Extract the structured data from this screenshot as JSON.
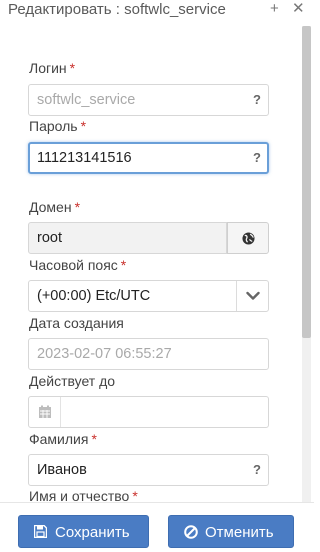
{
  "header": {
    "title": "Редактировать : softwlc_service",
    "plus_glyph": "+",
    "close_glyph": "✕"
  },
  "form": {
    "login": {
      "label": "Логин",
      "required_mark": "*",
      "value": "softwlc_service",
      "help": "?"
    },
    "password": {
      "label": "Пароль",
      "required_mark": "*",
      "value": "111213141516",
      "help": "?"
    },
    "domain": {
      "label": "Домен",
      "required_mark": "*",
      "value": "root",
      "button_icon": "globe-icon"
    },
    "timezone": {
      "label": "Часовой пояс",
      "required_mark": "*",
      "selected": "(+00:00) Etc/UTC",
      "icon": "chevron-down-icon"
    },
    "created": {
      "label": "Дата создания",
      "value": "2023-02-07 06:55:27"
    },
    "valid_until": {
      "label": "Действует до",
      "value": "",
      "icon": "calendar-icon"
    },
    "last_name": {
      "label": "Фамилия",
      "required_mark": "*",
      "value": "Иванов",
      "help": "?"
    },
    "first_name": {
      "label": "Имя и отчество",
      "required_mark": "*"
    }
  },
  "footer": {
    "save_label": "Сохранить",
    "cancel_label": "Отменить"
  },
  "colors": {
    "primary": "#4a7cc4",
    "required": "#c9302c",
    "focus_border": "#6a9fd8"
  }
}
